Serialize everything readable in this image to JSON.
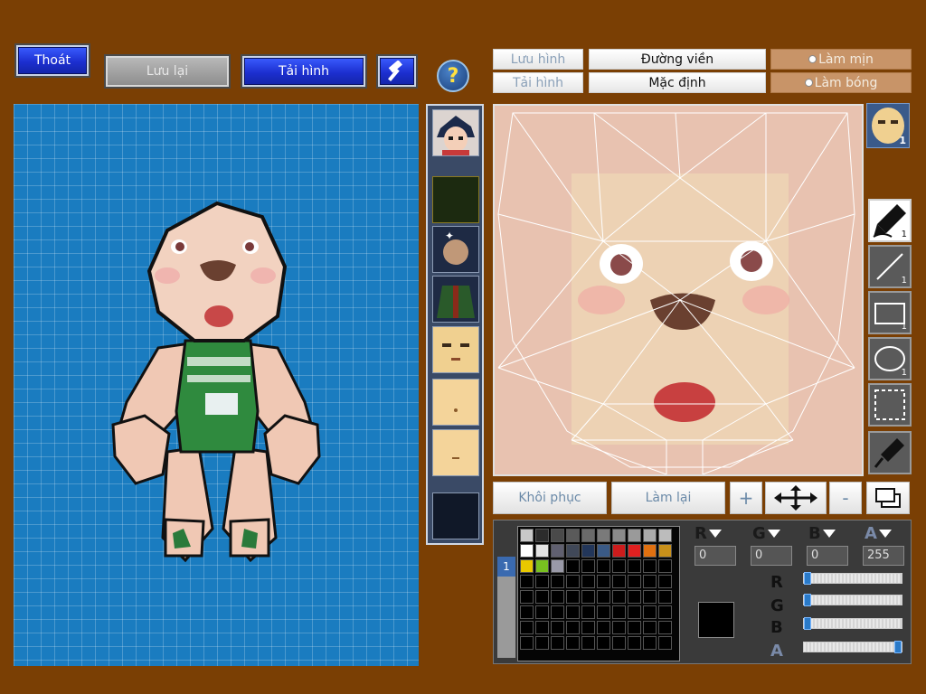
{
  "top_buttons": {
    "exit_label": "Thoát",
    "save_label": "Lưu lại",
    "load_label": "Tải hình",
    "help_symbol": "?"
  },
  "toolbar": {
    "save_image": "Lưu hình",
    "load_image": "Tải hình",
    "outline": "Đường viền",
    "default": "Mặc định",
    "smooth": "Làm mịn",
    "shine": "Làm bóng"
  },
  "tools": {
    "brush_count": "1",
    "line_count": "1",
    "rect_count": "1",
    "ellipse_count": "1",
    "face_badge_count": "1"
  },
  "actions": {
    "restore": "Khôi phục",
    "redo": "Làm lại",
    "plus": "+",
    "minus": "-"
  },
  "color_values": {
    "r": "0",
    "g": "0",
    "b": "0",
    "a": "255"
  },
  "palette_tab": "1",
  "slider_levels": {
    "r": 0,
    "g": 0,
    "b": 0,
    "a": 1
  },
  "current_color": "#000000",
  "palette_colors": [
    "#c8c8c8",
    "#2c2c2c",
    "#4a4a4a",
    "#5a5a5a",
    "#6a6a6a",
    "#7a7a7a",
    "#8a8a8a",
    "#9a9a9a",
    "#aaaaaa",
    "#bcbcbc",
    "#ffffff",
    "#e4e4e4",
    "#606070",
    "#404858",
    "#22365a",
    "#3a5a86",
    "#cc1c1c",
    "#e02020",
    "#e07010",
    "#c8901a",
    "#e8c800",
    "#78c020",
    "#9a9aa8",
    "#000000",
    "#000000",
    "#000000",
    "#000000",
    "#000000",
    "#000000",
    "#000000"
  ]
}
